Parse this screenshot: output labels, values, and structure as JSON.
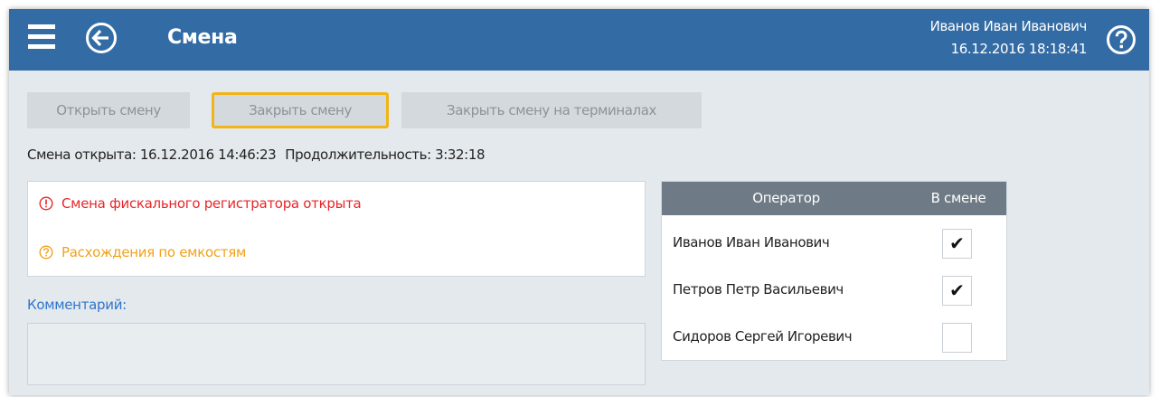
{
  "header": {
    "title": "Смена",
    "user_name": "Иванов Иван Иванович",
    "datetime": "16.12.2016 18:18:41",
    "background": "#336ca5"
  },
  "toolbar": {
    "open_shift_label": "Открыть смену",
    "close_shift_label": "Закрыть смену",
    "close_shift_terminals_label": "Закрыть смену на терминалах"
  },
  "status": {
    "opened_text": "Смена открыта: 16.12.2016 14:46:23",
    "duration_text": "Продолжительность: 3:32:18"
  },
  "alerts": [
    {
      "text": "Смена фискального регистратора открыта",
      "level": "error",
      "icon": "exclamation-circle-icon",
      "color": "#e8262a"
    },
    {
      "text": "Расхождения по емкостям",
      "level": "warning",
      "icon": "question-circle-icon",
      "color": "#f0a21c"
    }
  ],
  "comment": {
    "label": "Комментарий:",
    "value": ""
  },
  "operators_table": {
    "headers": {
      "operator": "Оператор",
      "in_shift": "В смене"
    },
    "rows": [
      {
        "name": "Иванов Иван Иванович",
        "in_shift": true,
        "mark": "✔"
      },
      {
        "name": "Петров Петр Васильевич",
        "in_shift": true,
        "mark": "✔"
      },
      {
        "name": "Сидоров Сергей Игоревич",
        "in_shift": false,
        "mark": ""
      }
    ]
  },
  "colors": {
    "accent_focus": "#f2b417",
    "link_blue": "#2f75cd",
    "page_background": "#e3e9ed"
  }
}
